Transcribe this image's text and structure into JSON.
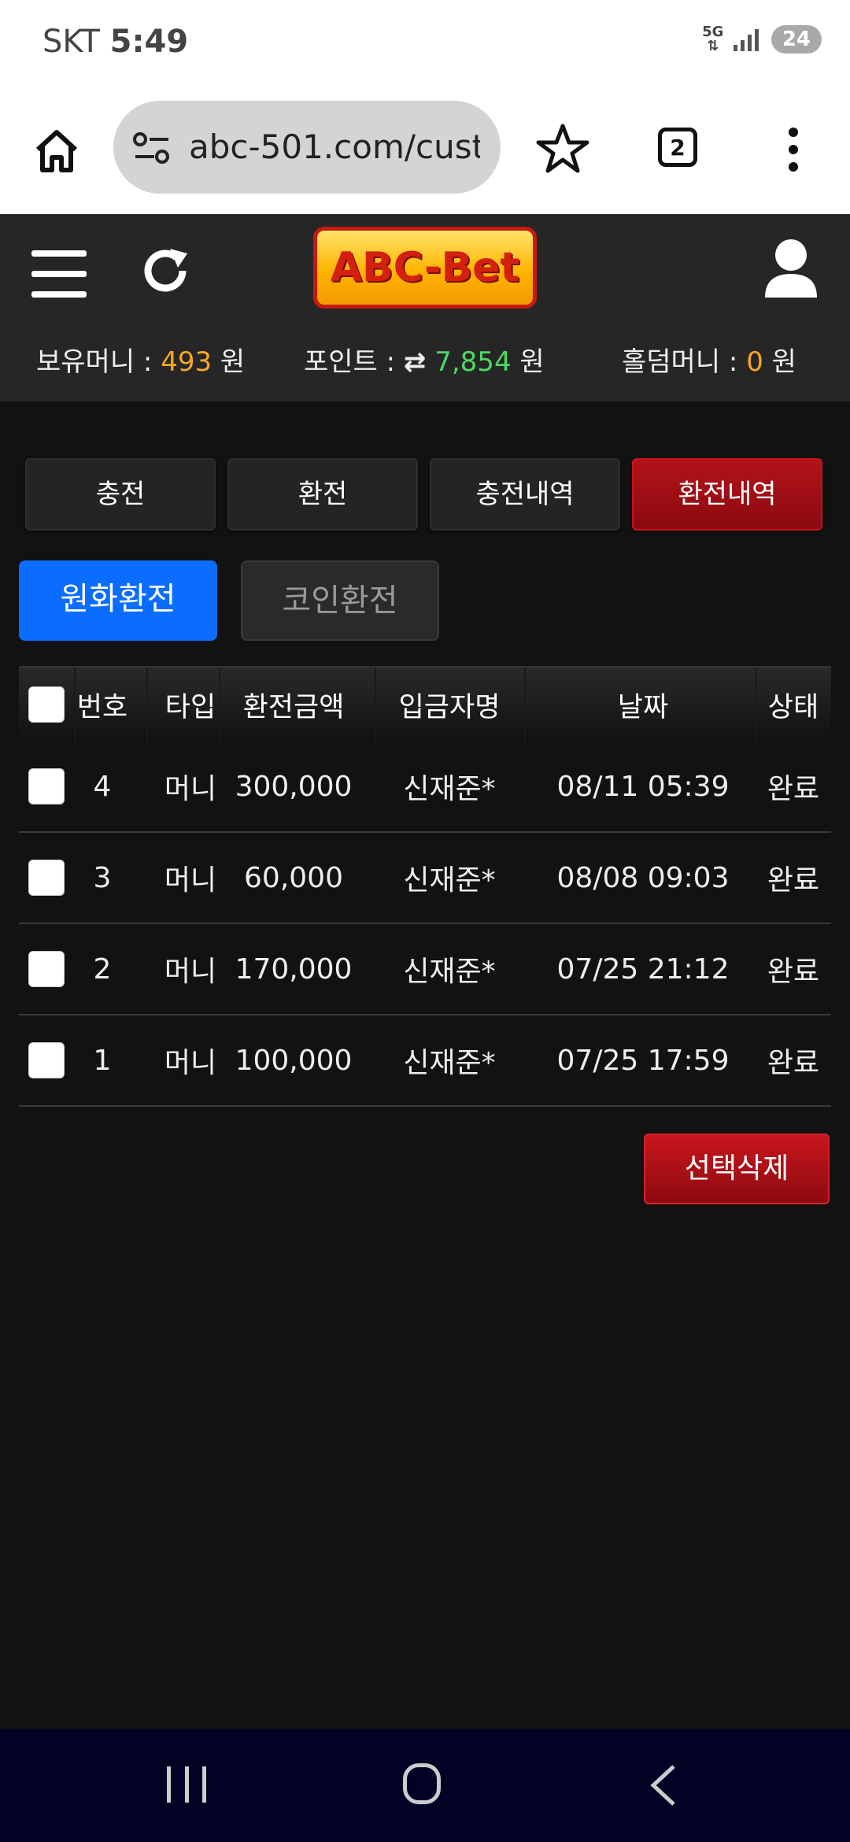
{
  "status_bar": {
    "carrier": "SKT",
    "time": "5:49",
    "network": "5G",
    "battery": "24"
  },
  "browser": {
    "url": "abc-501.com/customer",
    "tab_count": "2"
  },
  "site": {
    "logo_text": "ABC-Bet",
    "balance_label": "보유머니 :",
    "balance_value": "493",
    "balance_unit": "원",
    "point_label": "포인트 :",
    "point_value": "7,854",
    "point_unit": "원",
    "holdem_label": "홀덤머니 :",
    "holdem_value": "0",
    "holdem_unit": "원"
  },
  "main_tabs": [
    {
      "label": "충전"
    },
    {
      "label": "환전"
    },
    {
      "label": "충전내역"
    },
    {
      "label": "환전내역",
      "active": true
    }
  ],
  "sub_tabs": [
    {
      "label": "원화환전",
      "active": true
    },
    {
      "label": "코인환전"
    }
  ],
  "table": {
    "headers": [
      "번호",
      "타입",
      "환전금액",
      "입금자명",
      "날짜",
      "상태"
    ],
    "rows": [
      {
        "no": "4",
        "type": "머니",
        "amount": "300,000",
        "name": "신재준*",
        "date": "08/11 05:39",
        "status": "완료"
      },
      {
        "no": "3",
        "type": "머니",
        "amount": "60,000",
        "name": "신재준*",
        "date": "08/08 09:03",
        "status": "완료"
      },
      {
        "no": "2",
        "type": "머니",
        "amount": "170,000",
        "name": "신재준*",
        "date": "07/25 21:12",
        "status": "완료"
      },
      {
        "no": "1",
        "type": "머니",
        "amount": "100,000",
        "name": "신재준*",
        "date": "07/25 17:59",
        "status": "완료"
      }
    ]
  },
  "delete_button": "선택삭제",
  "colors": {
    "accent_red": "#b3121a",
    "accent_blue": "#0a6dff",
    "balance_orange": "#f5a623",
    "point_green": "#4cd964"
  }
}
